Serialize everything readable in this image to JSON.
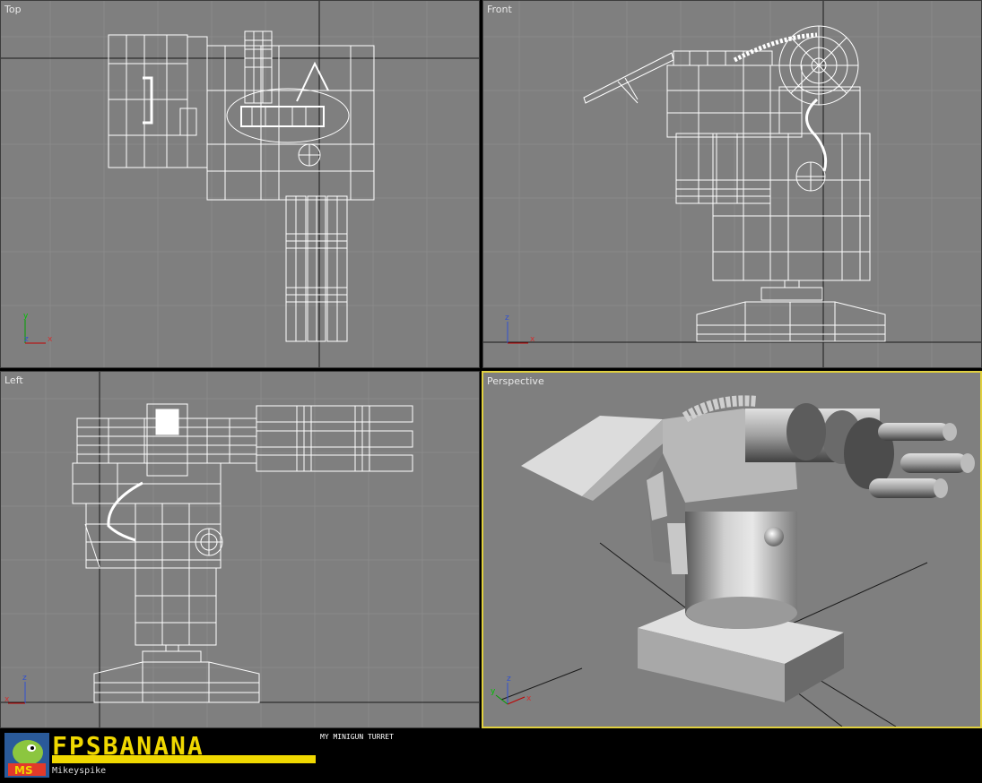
{
  "viewports": {
    "top": {
      "label": "Top"
    },
    "front": {
      "label": "Front"
    },
    "left": {
      "label": "Left"
    },
    "perspective": {
      "label": "Perspective"
    }
  },
  "axes": {
    "x": "x",
    "y": "y",
    "z": "z"
  },
  "footer": {
    "logo_text": "FPSBANANA",
    "caption": "MY MINIGUN TURRET",
    "author": "Mikeyspike",
    "badge": "MS"
  },
  "colors": {
    "viewport_bg": "#7f7f7f",
    "wire": "#ffffff",
    "grid": "#8c8c8c",
    "active_border": "#e0d040",
    "logo": "#f0d800"
  }
}
